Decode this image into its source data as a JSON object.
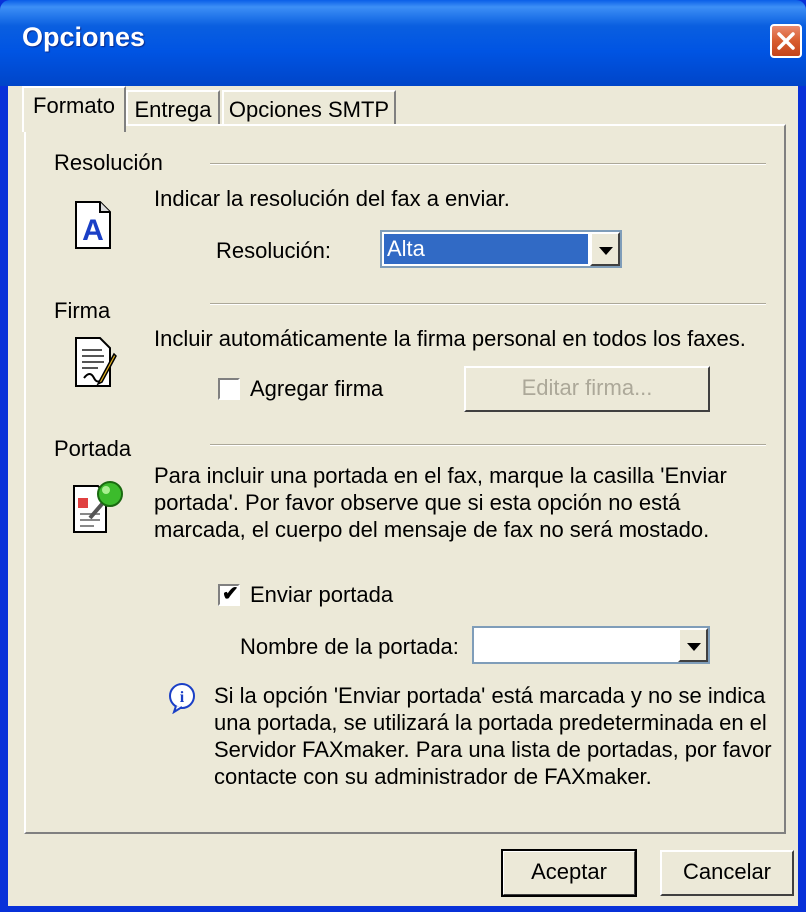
{
  "window": {
    "title": "Opciones"
  },
  "tabs": [
    {
      "label": "Formato",
      "active": true
    },
    {
      "label": "Entrega",
      "active": false
    },
    {
      "label": "Opciones SMTP",
      "active": false
    }
  ],
  "resolucion": {
    "section_label": "Resolución",
    "description": "Indicar la resolución del fax a enviar.",
    "field_label": "Resolución:",
    "selected_value": "Alta",
    "icon": "resolution-icon"
  },
  "firma": {
    "section_label": "Firma",
    "description": "Incluir automáticamente la firma personal en todos los faxes.",
    "checkbox_label": "Agregar firma",
    "checked": false,
    "edit_button_label": "Editar firma...",
    "icon": "signature-icon"
  },
  "portada": {
    "section_label": "Portada",
    "description": "Para incluir una portada en el fax, marque la casilla 'Enviar portada'.  Por favor observe que si esta opción no está marcada, el cuerpo del mensaje de fax no será mostado.",
    "checkbox_label": "Enviar portada",
    "checked": true,
    "name_label": "Nombre de la portada:",
    "name_value": "",
    "info_text": "Si la opción 'Enviar portada' está marcada y no se indica una portada, se utilizará la portada predeterminada en el Servidor FAXmaker.  Para una lista de portadas, por favor contacte con su administrador de FAXmaker.",
    "icon": "cover-page-icon"
  },
  "buttons": {
    "ok": "Aceptar",
    "cancel": "Cancelar"
  },
  "colors": {
    "titlebar": "#0054e3",
    "selection": "#316ac5",
    "close": "#d85c2e"
  }
}
